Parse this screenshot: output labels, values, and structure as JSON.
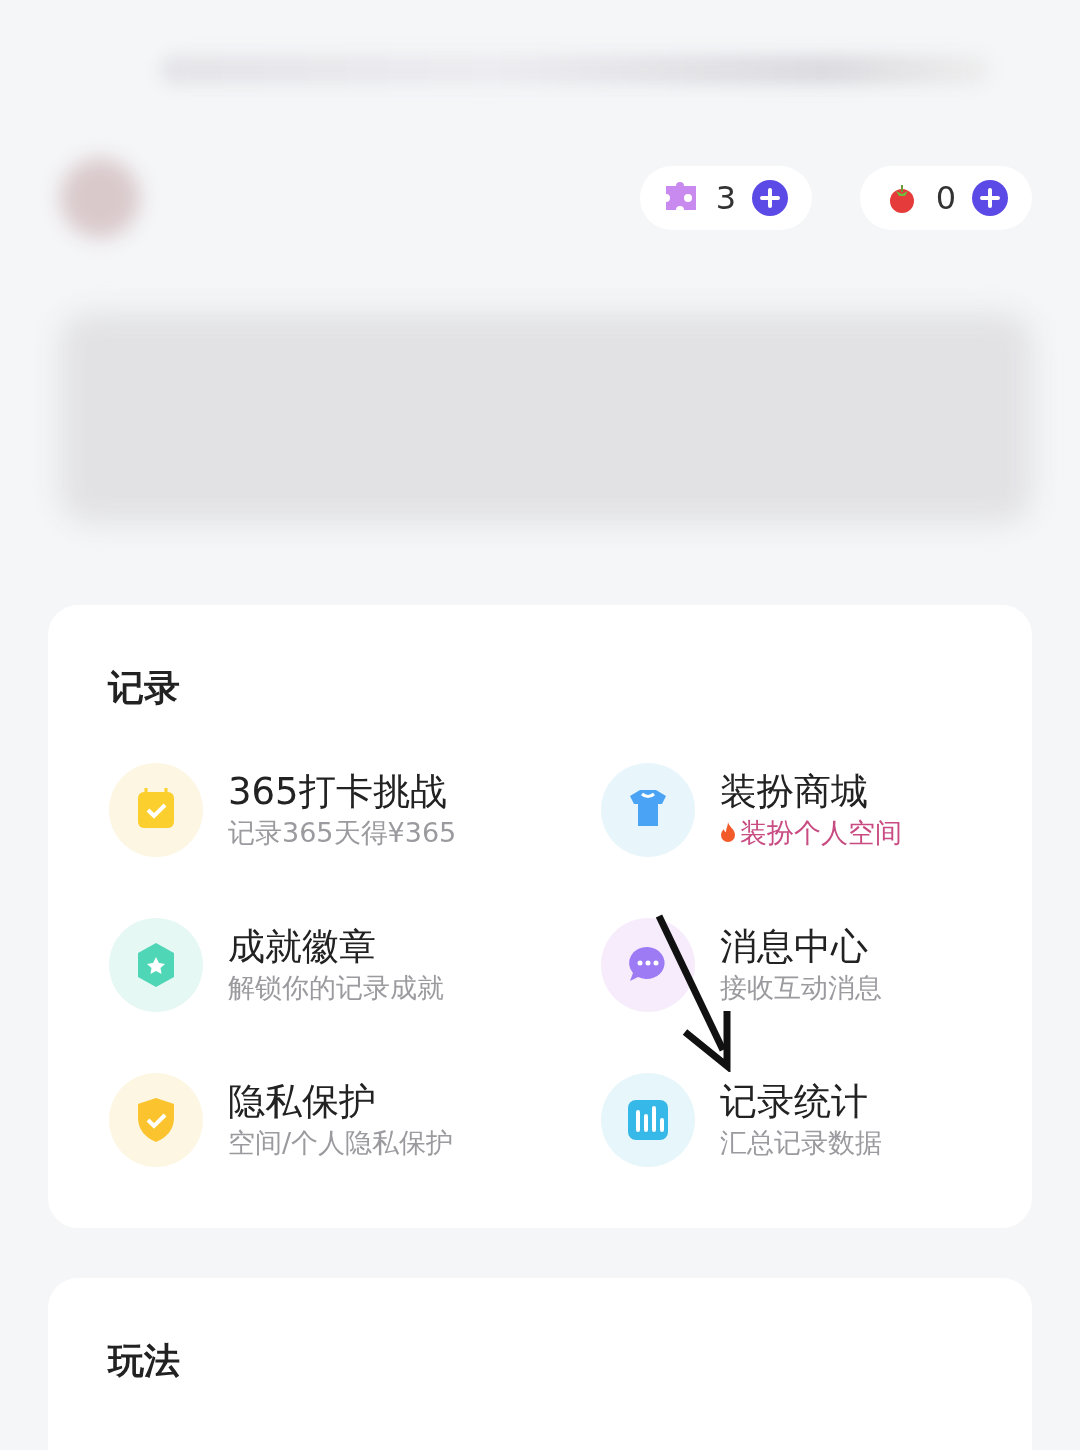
{
  "wallet": [
    {
      "kind": "puzzle",
      "count": "3"
    },
    {
      "kind": "tomato",
      "count": "0"
    }
  ],
  "sections": [
    {
      "title": "记录",
      "items": [
        {
          "title": "365打卡挑战",
          "subtitle": "记录365天得¥365",
          "hot": false
        },
        {
          "title": "装扮商城",
          "subtitle": "装扮个人空间",
          "hot": true
        },
        {
          "title": "成就徽章",
          "subtitle": "解锁你的记录成就",
          "hot": false
        },
        {
          "title": "消息中心",
          "subtitle": "接收互动消息",
          "hot": false
        },
        {
          "title": "隐私保护",
          "subtitle": "空间/个人隐私保护",
          "hot": false
        },
        {
          "title": "记录统计",
          "subtitle": "汇总记录数据",
          "hot": false
        }
      ]
    },
    {
      "title": "玩法"
    }
  ]
}
